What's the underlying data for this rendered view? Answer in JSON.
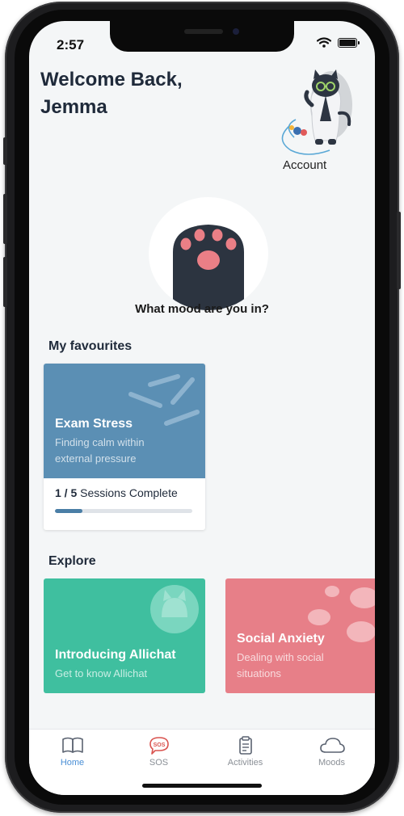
{
  "status_bar": {
    "time": "2:57"
  },
  "header": {
    "welcome_line1": "Welcome Back,",
    "welcome_line2": "Jemma"
  },
  "account": {
    "label": "Account"
  },
  "mood": {
    "prompt": "What mood are you in?"
  },
  "favourites": {
    "title": "My favourites",
    "cards": [
      {
        "title": "Exam Stress",
        "subtitle_line1": "Finding calm within",
        "subtitle_line2": "external pressure",
        "progress_current": "1 / 5",
        "progress_suffix": "Sessions Complete",
        "progress_fraction": 0.2,
        "color": "#5b8fb4"
      }
    ]
  },
  "explore": {
    "title": "Explore",
    "cards": [
      {
        "title": "Introducing Allichat",
        "subtitle_line1": "Get to know Allichat",
        "color": "#3fbf9f"
      },
      {
        "title": "Social Anxiety",
        "subtitle_line1": "Dealing with social",
        "subtitle_line2": "situations",
        "color": "#e77f88"
      }
    ]
  },
  "tabbar": {
    "items": [
      {
        "label": "Home",
        "icon": "book-icon",
        "active": true
      },
      {
        "label": "SOS",
        "icon": "sos-icon",
        "active": false
      },
      {
        "label": "Activities",
        "icon": "clipboard-icon",
        "active": false
      },
      {
        "label": "Moods",
        "icon": "cloud-icon",
        "active": false
      }
    ]
  },
  "colors": {
    "accent": "#4a8fd6",
    "background": "#f4f6f7",
    "sos": "#d9534f"
  }
}
